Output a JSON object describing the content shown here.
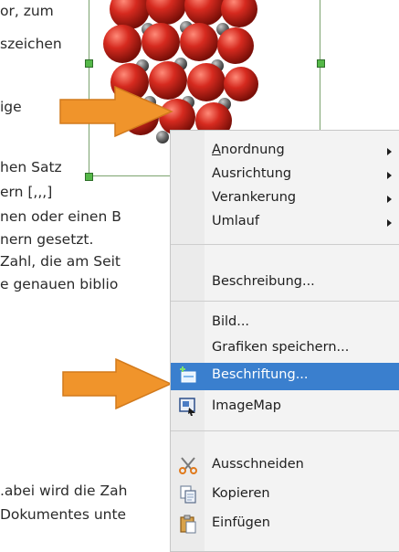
{
  "document": {
    "lines": [
      "or, zum",
      "szeichen",
      "ige",
      "hen Satz",
      "ern [,,,]",
      "nen oder einen B",
      "nern gesetzt.",
      "Zahl, die am Seit",
      "e genauen biblio",
      ".abei wird die Zah",
      "Dokumentes unte"
    ]
  },
  "context_menu": {
    "items": [
      {
        "label": "Anordnung",
        "accel": "A",
        "submenu": true
      },
      {
        "label": "Ausrichtung",
        "accel": "r",
        "submenu": true
      },
      {
        "label": "Verankerung",
        "accel": "V",
        "submenu": true
      },
      {
        "label": "Umlauf",
        "accel": "U",
        "submenu": true
      },
      {
        "label": "Beschreibung...",
        "accel": "s",
        "submenu": false
      },
      {
        "label": "Bild...",
        "accel": "B",
        "submenu": false
      },
      {
        "label": "Grafiken speichern...",
        "accel": "G",
        "submenu": false
      },
      {
        "label": "Beschriftung...",
        "accel": "c",
        "submenu": false,
        "highlighted": true,
        "icon": "insert-caption-icon"
      },
      {
        "label": "ImageMap",
        "accel": "I",
        "submenu": false,
        "icon": "imagemap-icon"
      },
      {
        "label": "Ausschneiden",
        "accel": "A",
        "submenu": false,
        "icon": "scissors-icon"
      },
      {
        "label": "Kopieren",
        "accel": "K",
        "submenu": false,
        "icon": "copy-icon"
      },
      {
        "label": "Einfügen",
        "accel": "i",
        "submenu": false,
        "icon": "paste-icon"
      }
    ]
  },
  "colors": {
    "highlight": "#3a7fce",
    "arrow": "#f0942b",
    "molecule_red": "#d62a1f",
    "molecule_gray": "#6b6b6b"
  }
}
